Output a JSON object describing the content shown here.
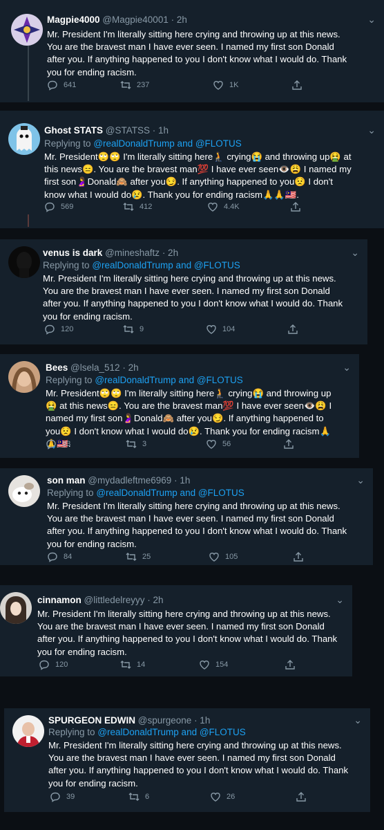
{
  "tweets": [
    {
      "name": "Magpie4000",
      "handle": "@Magpie40001",
      "time": "· 2h",
      "reply_prefix": "",
      "reply_targets": "",
      "body": "Mr. President I'm literally sitting here crying and throwing up at this news. You are the bravest man I have ever seen. I named my first son Donald after you. If anything happened to you I don't know what I would do. Thank you for ending racism.",
      "replies": "641",
      "retweets": "237",
      "likes": "1K"
    },
    {
      "name": "Ghost STATS",
      "handle": "@STATSS",
      "time": "· 1h",
      "reply_prefix": "Replying to",
      "reply_targets": "@realDonaldTrump and @FLOTUS",
      "body": "Mr. President🙄🙄 I'm literally sitting here🧎 crying😭 and throwing up🤮 at this news😑. You are the bravest man💯 I have ever seen👁️😩 I named my first son🤰Donald🙈 after you😏. If anything happened to you😟 I don't know what I would do😢. Thank you for ending racism🙏🙏🇲🇾.",
      "replies": "569",
      "retweets": "412",
      "likes": "4.4K"
    },
    {
      "name": "venus is dark",
      "handle": "@mineshaftz",
      "time": "· 2h",
      "reply_prefix": "Replying to",
      "reply_targets": "@realDonaldTrump and @FLOTUS",
      "body": "Mr. President I'm literally sitting here crying and throwing up at this news. You are the bravest man I have ever seen. I named my first son Donald after you. If anything happened to you I don't know what I would do. Thank you for ending racism.",
      "replies": "120",
      "retweets": "9",
      "likes": "104"
    },
    {
      "name": "Bees",
      "handle": "@lsela_512",
      "time": "· 2h",
      "reply_prefix": "Replying to",
      "reply_targets": "@realDonaldTrump and @FLOTUS",
      "body": "Mr. President🙄🙄 I'm literally sitting here🧎 crying😭 and throwing up🤮 at this news😑. You are the bravest man💯 I have ever seen👁️😩 I named my first son🤰Donald🙈 after you😏. If anything happened to you😟 I don't know what I would do😢. Thank you for ending racism🙏🙏🇲🇾.",
      "replies": "33",
      "retweets": "3",
      "likes": "56"
    },
    {
      "name": "son man",
      "handle": "@mydadleftme6969",
      "time": "· 1h",
      "reply_prefix": "Replying to",
      "reply_targets": "@realDonaldTrump and @FLOTUS",
      "body": "Mr. President I'm literally sitting here crying and throwing up at this news. You are the bravest man I have ever seen. I named my first son Donald after you. If anything happened to you I don't know what I would do. Thank you for ending racism.",
      "replies": "84",
      "retweets": "25",
      "likes": "105"
    },
    {
      "name": "cinnamon",
      "handle": "@littledelreyyy",
      "time": "· 2h",
      "reply_prefix": "",
      "reply_targets": "",
      "body": "Mr. President I'm literally sitting here crying and throwing up at this news. You are the bravest man I have ever seen. I named my first son Donald after you. If anything happened to you I don't know what I would do. Thank you for ending racism.",
      "replies": "120",
      "retweets": "14",
      "likes": "154"
    },
    {
      "name": "SPURGEON EDWIN",
      "handle": "@spurgeone",
      "time": "· 1h",
      "reply_prefix": "Replying to",
      "reply_targets": "@realDonaldTrump and @FLOTUS",
      "body": "Mr. President I'm literally sitting here crying and throwing up at this news. You are the bravest man I have ever seen. I named my first son Donald after you. If anything happened to you I don't know what I would do. Thank you for ending racism.",
      "replies": "39",
      "retweets": "6",
      "likes": "26"
    }
  ],
  "icons": {
    "reply": "reply-icon",
    "retweet": "retweet-icon",
    "like": "heart-icon",
    "share": "share-icon",
    "more": "chevron-down-icon"
  },
  "colors": {
    "background": "#15202b",
    "page": "#0b0f14",
    "link": "#1da1f2",
    "muted": "#8899a6",
    "text": "#ffffff"
  }
}
